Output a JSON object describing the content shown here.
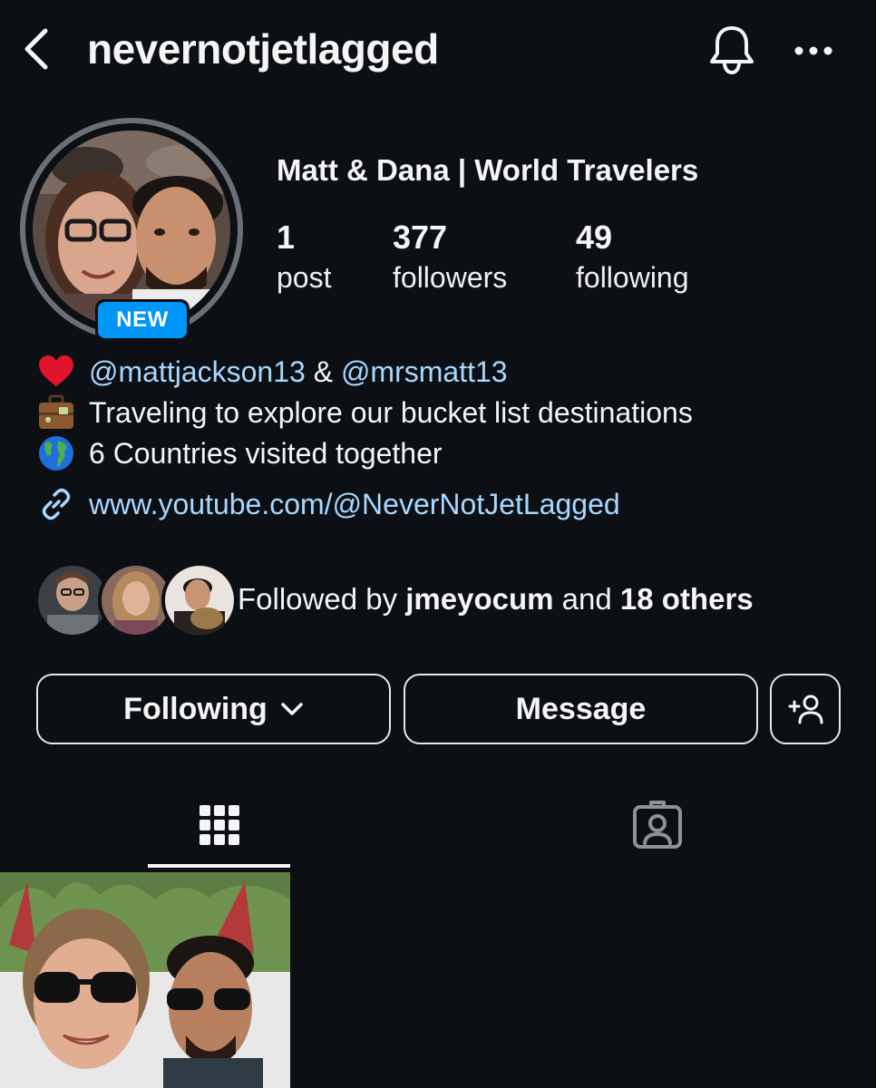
{
  "header": {
    "username": "nevernotjetlagged",
    "back_icon": "chevron-left-icon",
    "bell_icon": "bell-icon",
    "more_icon": "more-horizontal-icon"
  },
  "profile": {
    "badge": "NEW",
    "display_name": "Matt & Dana | World Travelers",
    "stats": [
      {
        "value": "1",
        "label": "post"
      },
      {
        "value": "377",
        "label": "followers"
      },
      {
        "value": "49",
        "label": "following"
      }
    ]
  },
  "bio": {
    "line1": {
      "emoji": "red-heart-icon",
      "mention1": "@mattjackson13",
      "separator": " & ",
      "mention2": "@mrsmatt13"
    },
    "line2": {
      "emoji": "suitcase-icon",
      "text": "Traveling to explore our bucket list destinations"
    },
    "line3": {
      "emoji": "globe-icon",
      "text": "6 Countries visited together"
    },
    "link": {
      "icon": "link-icon",
      "text": "www.youtube.com/@NeverNotJetLagged"
    }
  },
  "followed_by": {
    "prefix": "Followed by ",
    "user": "jmeyocum",
    "middle": " and ",
    "others": "18 others"
  },
  "actions": {
    "following_label": "Following",
    "message_label": "Message",
    "add_user_icon": "add-user-icon"
  },
  "tabs": {
    "grid_icon": "grid-icon",
    "tagged_icon": "tagged-icon",
    "active": "grid"
  },
  "colors": {
    "background": "#0c1014",
    "link": "#a8d7ff",
    "badge": "#0095f6",
    "text": "#f5f5f5"
  }
}
